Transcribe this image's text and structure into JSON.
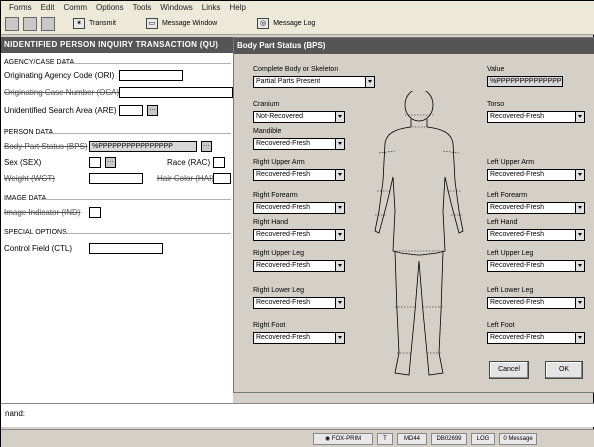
{
  "menu": [
    "Forms",
    "Edit",
    "Comm",
    "Options",
    "Tools",
    "Windows",
    "Links",
    "Help"
  ],
  "toolbar": {
    "transmit_label": "Transmit",
    "message_window_label": "Message Window",
    "message_log_label": "Message Log"
  },
  "left_panel": {
    "title": "NIDENTIFIED PERSON INQUIRY TRANSACTION (QU)",
    "agency_section": "AGENCY/CASE DATA",
    "ori_label": "Originating Agency Code (ORI)",
    "ori_value": "",
    "oca_label": "Originating Case Number (OCA)",
    "oca_value": "",
    "are_label": "Unidentified Search Area (ARE)",
    "are_value": "",
    "person_section": "PERSON DATA",
    "bps_label": "Body Part Status (BPS)",
    "bps_value": "%PPPPPPPPPPPPPPPP",
    "sex_label": "Sex (SEX)",
    "race_label": "Race (RAC)",
    "wgt_label": "Weight (WGT)",
    "hai_label": "Hair Color (HAI)",
    "image_section": "IMAGE DATA",
    "ind_label": "Image Indicator (IND)",
    "special_section": "SPECIAL OPTIONS",
    "ctl_label": "Control Field (CTL)"
  },
  "dialog": {
    "title": "Body Part Status (BPS)",
    "complete_label": "Complete Body or Skeleton",
    "complete_value": "Partial Parts Present",
    "value_label": "Value",
    "value_text": "%PPPPPPPPPPPPPPPP",
    "cranium_label": "Cranium",
    "cranium_value": "Not-Recovered",
    "torso_label": "Torso",
    "torso_value": "Recovered-Fresh",
    "mandible_label": "Mandible",
    "mandible_value": "Recovered-Fresh",
    "rua_label": "Right Upper Arm",
    "rua_value": "Recovered-Fresh",
    "lua_label": "Left Upper Arm",
    "lua_value": "Recovered-Fresh",
    "rfa_label": "Right Forearm",
    "rfa_value": "Recovered-Fresh",
    "lfa_label": "Left Forearm",
    "lfa_value": "Recovered-Fresh",
    "rh_label": "Right Hand",
    "rh_value": "Recovered-Fresh",
    "lh_label": "Left Hand",
    "lh_value": "Recovered-Fresh",
    "rul_label": "Right Upper Leg",
    "rul_value": "Recovered-Fresh",
    "lul_label": "Left Upper Leg",
    "lul_value": "Recovered-Fresh",
    "rll_label": "Right Lower Leg",
    "rll_value": "Recovered-Fresh",
    "lll_label": "Left Lower Leg",
    "lll_value": "Recovered-Fresh",
    "rf_label": "Right Foot",
    "rf_value": "Recovered-Fresh",
    "lf_label": "Left Foot",
    "lf_value": "Recovered-Fresh",
    "cancel_label": "Cancel",
    "ok_label": "OK"
  },
  "command": {
    "label": "nand:"
  },
  "status": {
    "server": "FOX-PRIM",
    "t": "T",
    "md": "MD44",
    "code": "DB02699",
    "log": "LOG",
    "messages": "0 Message"
  }
}
